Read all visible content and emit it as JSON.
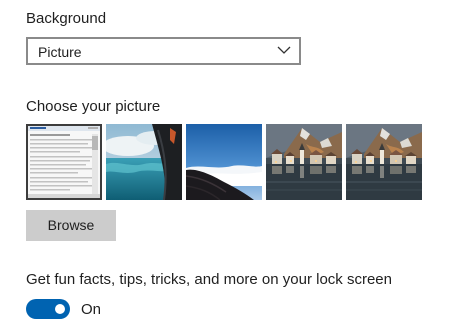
{
  "background": {
    "label": "Background",
    "dropdown": {
      "selected": "Picture",
      "icon": "chevron-down-icon"
    }
  },
  "choose_picture": {
    "label": "Choose your picture",
    "thumbnails": [
      {
        "name": "screenshot-document",
        "selected": true
      },
      {
        "name": "aerial-sea-cliff",
        "selected": false
      },
      {
        "name": "clouds-mountain-slope",
        "selected": false
      },
      {
        "name": "lakeside-village",
        "selected": false
      },
      {
        "name": "lakeside-village",
        "selected": false
      }
    ],
    "browse_label": "Browse"
  },
  "lock_screen": {
    "fun_facts_label": "Get fun facts, tips, tricks, and more on your lock screen",
    "toggle_state": "On",
    "toggle_on": true
  },
  "colors": {
    "accent": "#0063b1",
    "button_bg": "#cccccc",
    "dropdown_border": "#8a8a8a"
  }
}
